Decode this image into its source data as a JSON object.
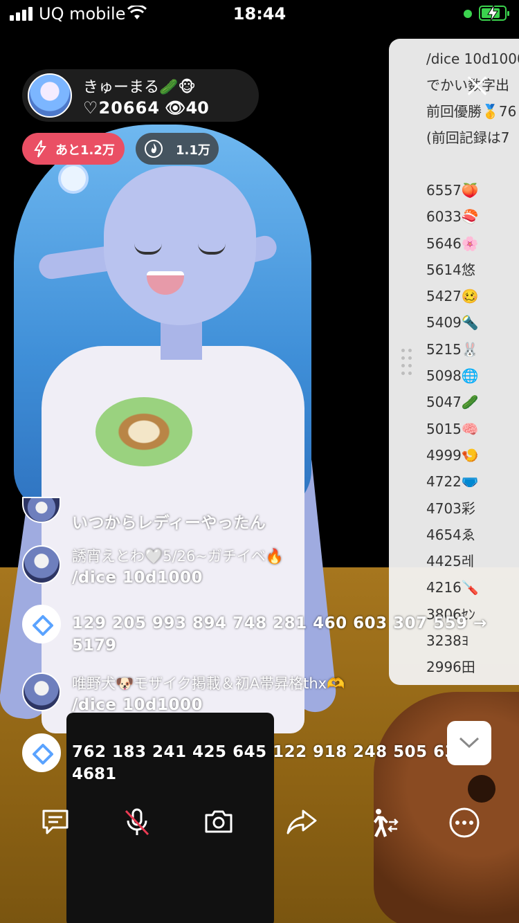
{
  "status_bar": {
    "carrier": "UQ mobile",
    "time": "18:44"
  },
  "streamer": {
    "name": "きゅーまる🥒🐵",
    "likes": "♡20664",
    "viewers": "👁40"
  },
  "badges": {
    "remaining": "あと1.2万",
    "fire": "1.1万"
  },
  "dice_panel": {
    "header_lines": [
      "/dice 10d1000",
      "でかい数字出",
      "前回優勝🥇76",
      "(前回記録は7"
    ],
    "scores": [
      "6557🍑",
      "6033🍣",
      "5646🌸",
      "5614悠",
      "5427🥴",
      "5409🔦",
      "5215🐰",
      "5098🌐",
      "5047🥒",
      "5015🧠",
      "4999🍤",
      "4722🩲",
      "4703彩",
      "4654ゑ",
      "4425레",
      "4216🪛",
      "3806ｾﾝ",
      "3238ﾖ",
      "2996田"
    ]
  },
  "chat": [
    {
      "name": "",
      "message": "いつからレディーやったん"
    },
    {
      "name": "誘宵えとわ🤍5/26~ガチイベ🔥",
      "message": "/dice 10d1000"
    },
    {
      "name": "",
      "message": "129 205 993 894 748 281 460 603 307 559 →",
      "message2": "5179"
    },
    {
      "name": "唯野犬🐶モザイク掲載＆初A帯昇格thx🫶",
      "message": "/dice 10d1000"
    },
    {
      "name": "",
      "message": "762 183 241 425 645 122 918 248 505 632 →",
      "message2": "4681"
    }
  ],
  "toolbar_icons": [
    "chat-icon",
    "mic-muted-icon",
    "camera-icon",
    "share-icon",
    "walk-icon",
    "more-icon"
  ],
  "colors": {
    "badge_red": "#ea4f64",
    "panel_bg": "#f2f2f2",
    "battery_green": "#3bd34e"
  }
}
